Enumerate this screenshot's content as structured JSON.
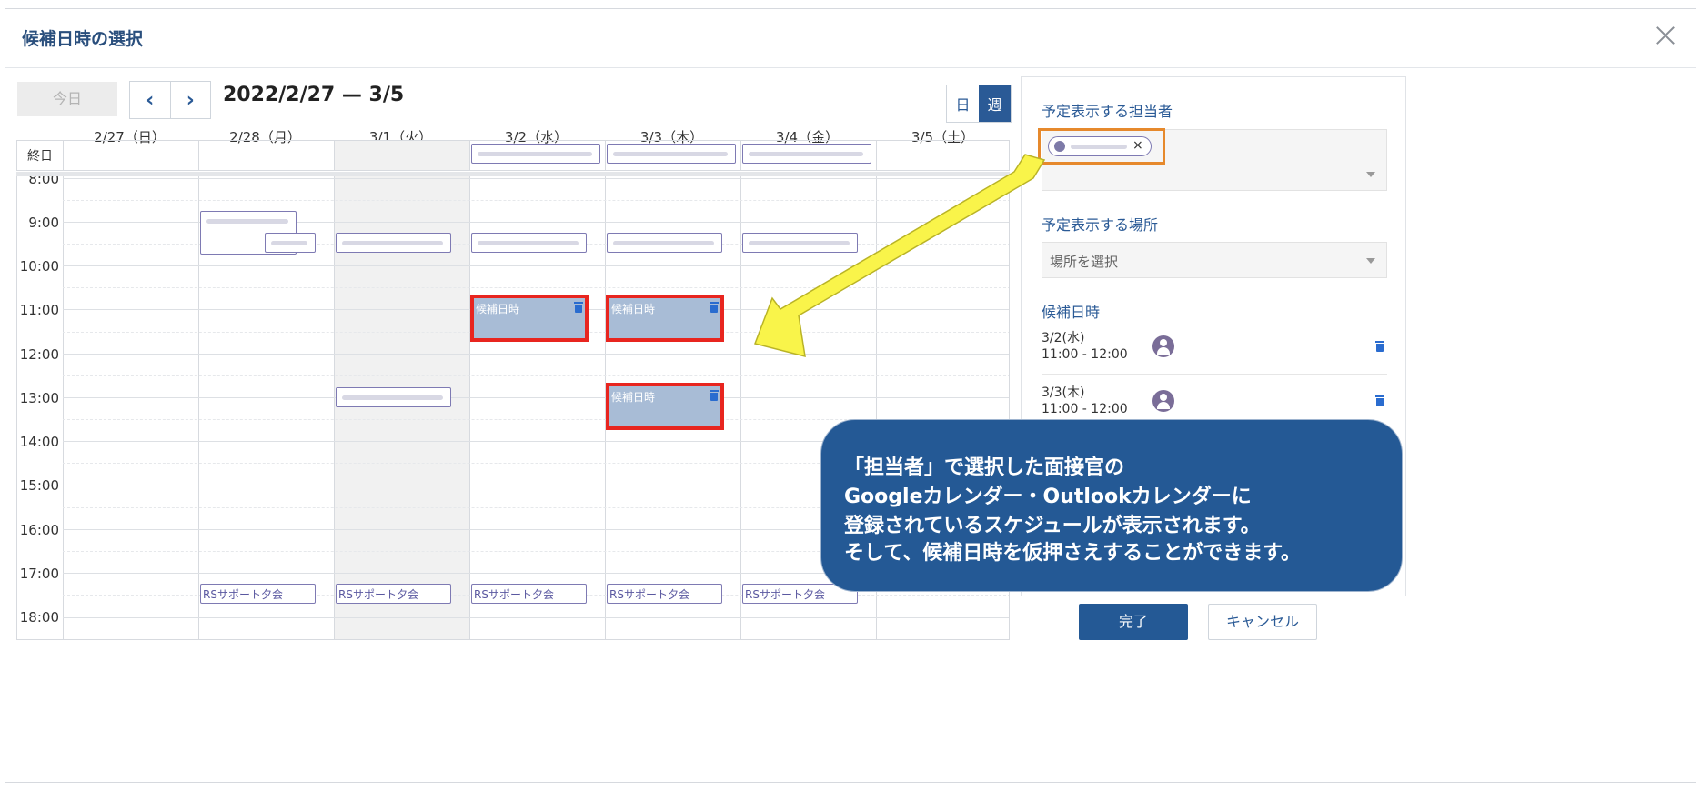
{
  "dialog": {
    "title": "候補日時の選択"
  },
  "toolbar": {
    "today": "今日",
    "prev": "‹",
    "next": "›",
    "range": "2022/2/27 — 3/5",
    "view_day": "日",
    "view_week": "週"
  },
  "calendar": {
    "days": [
      "2/27（日）",
      "2/28（月）",
      "3/1（火）",
      "3/2（水）",
      "3/3（木）",
      "3/4（金）",
      "3/5（土）"
    ],
    "allday_label": "終日",
    "times": [
      "8:00",
      "9:00",
      "10:00",
      "11:00",
      "12:00",
      "13:00",
      "14:00",
      "15:00",
      "16:00",
      "17:00",
      "18:00"
    ],
    "recurring_event": "RSサポート夕会",
    "candidate_label": "候補日時"
  },
  "panel": {
    "assignee_label": "予定表示する担当者",
    "chip_remove": "×",
    "location_label": "予定表示する場所",
    "location_placeholder": "場所を選択",
    "candidates_label": "候補日時",
    "candidates": [
      {
        "date": "3/2(水)",
        "time": "11:00 - 12:00"
      },
      {
        "date": "3/3(木)",
        "time": "11:00 - 12:00"
      }
    ]
  },
  "actions": {
    "done": "完了",
    "cancel": "キャンセル"
  },
  "callout": {
    "lines": [
      "「担当者」で選択した面接官の",
      "Googleカレンダー・Outlookカレンダーに",
      "登録されているスケジュールが表示されます。",
      "そして、候補日時を仮押さえすることができます。"
    ]
  },
  "colors": {
    "accent": "#245995",
    "candidate_border": "#e8251f",
    "candidate_fill": "#a8bcd6",
    "highlight": "#e6892c",
    "arrow": "#f9f44a"
  }
}
